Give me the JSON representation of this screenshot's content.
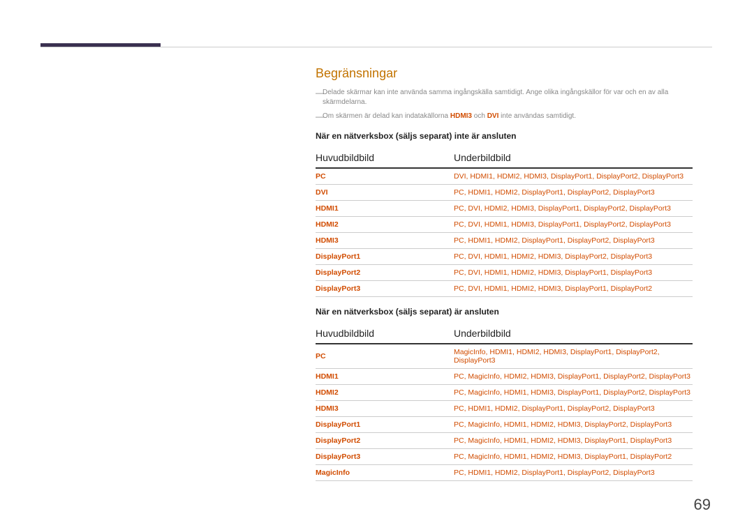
{
  "section_title": "Begränsningar",
  "note1_pre": "Delade skärmar kan inte använda samma ingångskälla samtidigt. Ange olika ingångskällor för var och en av alla skärmdelarna.",
  "note2_pre": "Om skärmen är delad kan indatakällorna ",
  "note2_hl1": "HDMI3",
  "note2_mid": " och ",
  "note2_hl2": "DVI",
  "note2_post": " inte användas samtidigt.",
  "table1_caption": "När en nätverksbox (säljs separat) inte är ansluten",
  "col_main": "Huvudbildbild",
  "col_sub": "Underbildbild",
  "table1_rows": [
    {
      "k": "PC",
      "v": "DVI, HDMI1, HDMI2, HDMI3, DisplayPort1, DisplayPort2, DisplayPort3"
    },
    {
      "k": "DVI",
      "v": "PC, HDMI1, HDMI2, DisplayPort1, DisplayPort2, DisplayPort3"
    },
    {
      "k": "HDMI1",
      "v": "PC, DVI, HDMI2, HDMI3, DisplayPort1, DisplayPort2, DisplayPort3"
    },
    {
      "k": "HDMI2",
      "v": "PC, DVI, HDMI1, HDMI3, DisplayPort1, DisplayPort2, DisplayPort3"
    },
    {
      "k": "HDMI3",
      "v": "PC, HDMI1, HDMI2, DisplayPort1, DisplayPort2, DisplayPort3"
    },
    {
      "k": "DisplayPort1",
      "v": "PC, DVI, HDMI1, HDMI2, HDMI3, DisplayPort2, DisplayPort3"
    },
    {
      "k": "DisplayPort2",
      "v": "PC, DVI, HDMI1, HDMI2, HDMI3, DisplayPort1, DisplayPort3"
    },
    {
      "k": "DisplayPort3",
      "v": "PC, DVI, HDMI1, HDMI2, HDMI3, DisplayPort1, DisplayPort2"
    }
  ],
  "table2_caption": "När en nätverksbox (säljs separat) är ansluten",
  "table2_rows": [
    {
      "k": "PC",
      "v": "MagicInfo, HDMI1, HDMI2, HDMI3, DisplayPort1, DisplayPort2, DisplayPort3"
    },
    {
      "k": "HDMI1",
      "v": "PC, MagicInfo, HDMI2, HDMI3, DisplayPort1, DisplayPort2, DisplayPort3"
    },
    {
      "k": "HDMI2",
      "v": "PC, MagicInfo, HDMI1, HDMI3, DisplayPort1, DisplayPort2, DisplayPort3"
    },
    {
      "k": "HDMI3",
      "v": "PC, HDMI1, HDMI2, DisplayPort1, DisplayPort2, DisplayPort3"
    },
    {
      "k": "DisplayPort1",
      "v": "PC, MagicInfo, HDMI1, HDMI2, HDMI3, DisplayPort2, DisplayPort3"
    },
    {
      "k": "DisplayPort2",
      "v": "PC, MagicInfo, HDMI1, HDMI2, HDMI3, DisplayPort1, DisplayPort3"
    },
    {
      "k": "DisplayPort3",
      "v": "PC, MagicInfo, HDMI1, HDMI2, HDMI3, DisplayPort1, DisplayPort2"
    },
    {
      "k": "MagicInfo",
      "v": "PC, HDMI1, HDMI2, DisplayPort1, DisplayPort2, DisplayPort3"
    }
  ],
  "page_number": "69"
}
